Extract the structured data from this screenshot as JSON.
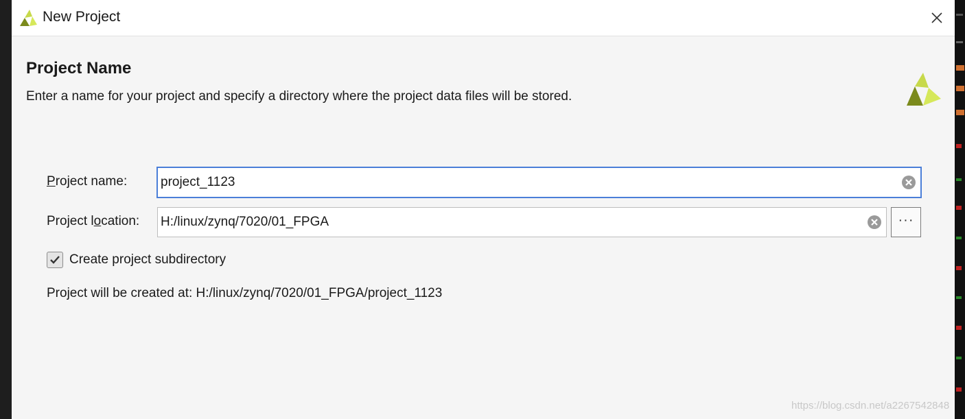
{
  "window": {
    "title": "New Project"
  },
  "page": {
    "title": "Project Name",
    "description": "Enter a name for your project and specify a directory where the project data files will be stored."
  },
  "form": {
    "project_name": {
      "label_first": "P",
      "label_rest": "roject name:",
      "value": "project_1123"
    },
    "project_location": {
      "label_pre": "Project l",
      "label_accel": "o",
      "label_post": "cation:",
      "value": "H:/linux/zynq/7020/01_FPGA",
      "browse_label": "···"
    },
    "create_subdirectory": {
      "label": "Create project subdirectory",
      "checked": true
    },
    "result": {
      "prefix": "Project will be created at: ",
      "path": "H:/linux/zynq/7020/01_FPGA/project_1123"
    }
  },
  "watermark": "https://blog.csdn.net/a2267542848",
  "colors": {
    "focus_border": "#4a7ed8",
    "logo_dark": "#7b8a1c",
    "logo_light": "#d6e85a",
    "dialog_bg": "#f5f5f5"
  },
  "icons": {
    "app": "xilinx-logo-icon",
    "close": "close-icon",
    "clear": "clear-circle-icon",
    "check": "checkmark-icon"
  }
}
